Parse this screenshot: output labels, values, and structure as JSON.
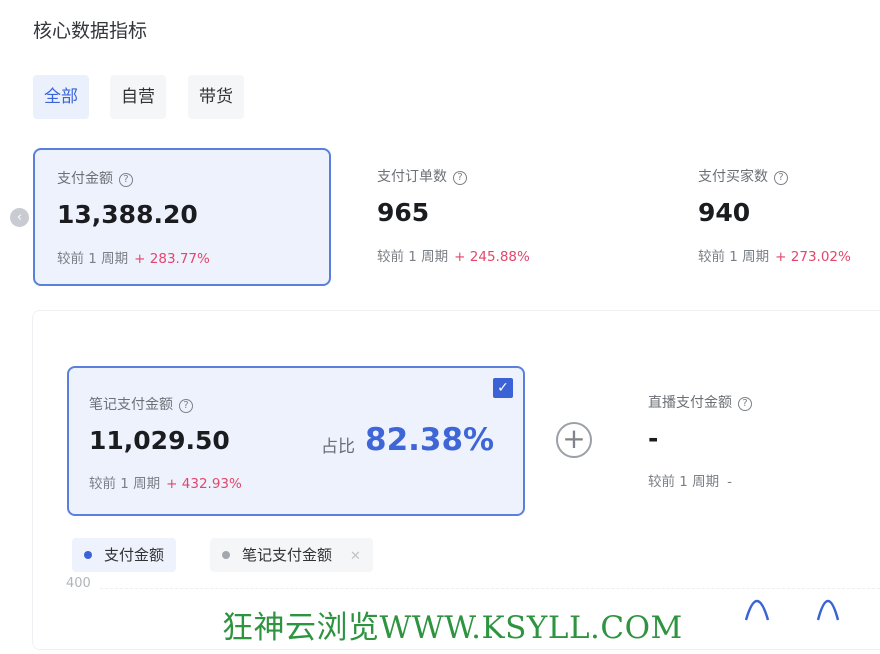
{
  "header": {
    "title": "核心数据指标"
  },
  "tabs": [
    {
      "label": "全部",
      "active": true
    },
    {
      "label": "自营",
      "active": false
    },
    {
      "label": "带货",
      "active": false
    }
  ],
  "metrics": [
    {
      "label": "支付金额",
      "value": "13,388.20",
      "compare_label": "较前 1 周期",
      "change": "+ 283.77%",
      "selected": true
    },
    {
      "label": "支付订单数",
      "value": "965",
      "compare_label": "较前 1 周期",
      "change": "+ 245.88%",
      "selected": false
    },
    {
      "label": "支付买家数",
      "value": "940",
      "compare_label": "较前 1 周期",
      "change": "+ 273.02%",
      "selected": false
    }
  ],
  "breakdown": {
    "note_payment": {
      "label": "笔记支付金额",
      "value": "11,029.50",
      "compare_label": "较前 1 周期",
      "change": "+ 432.93%",
      "ratio_label": "占比",
      "ratio_value": "82.38%",
      "checked": true
    },
    "live_payment": {
      "label": "直播支付金额",
      "value": "-",
      "compare_label": "较前 1 周期",
      "change": "-"
    }
  },
  "chart": {
    "legend": [
      {
        "name": "支付金额",
        "color": "#3b63d6"
      },
      {
        "name": "笔记支付金额",
        "color": "#a3a8ae"
      }
    ],
    "y_tick": "400"
  },
  "colors": {
    "accent": "#3b63d6",
    "positive_change": "#e2476b",
    "watermark": "#2e9440"
  },
  "watermark": "狂神云浏览WWW.KSYLL.COM"
}
